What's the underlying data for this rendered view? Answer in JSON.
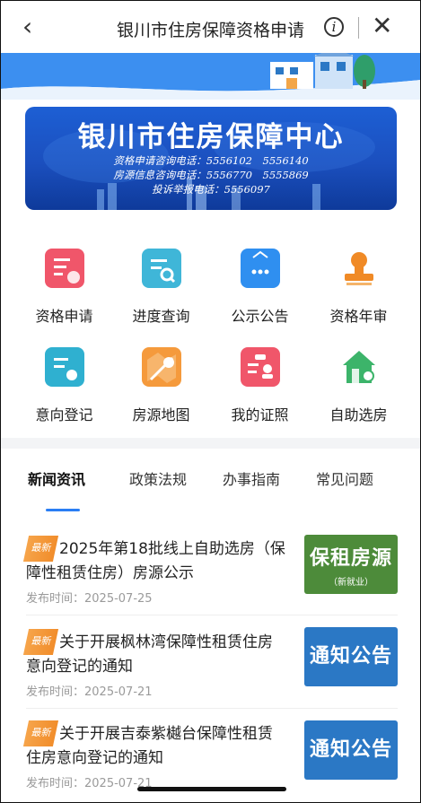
{
  "header": {
    "title": "银川市住房保障资格申请",
    "info_glyph": "i"
  },
  "banner": {
    "title": "银川市住房保障中心",
    "lines": [
      "资格申请咨询电话：5556102　5556140",
      "房源信息咨询电话：5556770　5555869",
      "投诉举报电话：5556097"
    ]
  },
  "menu": [
    {
      "label": "资格申请",
      "icon": "form-pen-icon",
      "color": "#f0566a"
    },
    {
      "label": "进度查询",
      "icon": "doc-search-icon",
      "color": "#3fb6d8"
    },
    {
      "label": "公示公告",
      "icon": "announcement-board-icon",
      "color": "#2f8ff0"
    },
    {
      "label": "资格年审",
      "icon": "stamp-icon",
      "color": "#f08a26"
    },
    {
      "label": "意向登记",
      "icon": "clipboard-heart-icon",
      "color": "#2fb0d0"
    },
    {
      "label": "房源地图",
      "icon": "map-pin-icon",
      "color": "#f59a3c"
    },
    {
      "label": "我的证照",
      "icon": "id-card-icon",
      "color": "#f0566a"
    },
    {
      "label": "自助选房",
      "icon": "house-search-icon",
      "color": "#3cb46a"
    }
  ],
  "tabs": [
    {
      "label": "新闻资讯",
      "active": true
    },
    {
      "label": "政策法规",
      "active": false
    },
    {
      "label": "办事指南",
      "active": false
    },
    {
      "label": "常见问题",
      "active": false
    }
  ],
  "news": [
    {
      "badge": "最新",
      "title": "2025年第18批线上自助选房（保障性租赁住房）房源公示",
      "date": "发布时间：2025-07-25",
      "thumb_main": "保租房源",
      "thumb_sub": "（新就业）"
    },
    {
      "badge": "最新",
      "title": "关于开展枫林湾保障性租赁住房意向登记的通知",
      "date": "发布时间：2025-07-21",
      "thumb_main": "通知公告",
      "thumb_sub": ""
    },
    {
      "badge": "最新",
      "title": "关于开展吉泰紫樾台保障性租赁住房意向登记的通知",
      "date": "发布时间：2025-07-21",
      "thumb_main": "通知公告",
      "thumb_sub": ""
    }
  ]
}
